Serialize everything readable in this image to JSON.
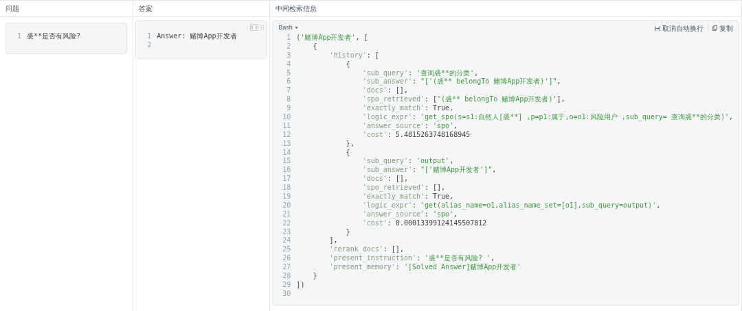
{
  "columns": [
    {
      "header": "问题"
    },
    {
      "header": "答案"
    },
    {
      "header": "中间检索信息"
    }
  ],
  "question": {
    "lines": [
      {
        "n": "1",
        "text": "裘**是否有风险?"
      }
    ]
  },
  "answer": {
    "lines": [
      {
        "n": "1",
        "text": "Answer: 赌博App开发者"
      },
      {
        "n": "2"
      }
    ]
  },
  "retrieval": {
    "language": "Bash",
    "actions": [
      {
        "kind": "wrap",
        "label": "取消自动换行"
      },
      {
        "kind": "copy",
        "label": "复制"
      }
    ],
    "lines": [
      {
        "n": "1",
        "text": "('赌博App开发者', ["
      },
      {
        "n": "2",
        "text": "    {"
      },
      {
        "n": "3",
        "text": "        'history': ["
      },
      {
        "n": "4",
        "text": "            {"
      },
      {
        "n": "5",
        "text": "                'sub_query': '查询裘**的分类',"
      },
      {
        "n": "6",
        "text": "                'sub_answer': \"['(裘** belongTo 赌博App开发者)']\","
      },
      {
        "n": "7",
        "text": "                'docs': [],"
      },
      {
        "n": "8",
        "text": "                'spo_retrieved': ['(裘** belongTo 赌博App开发者)'],"
      },
      {
        "n": "9",
        "text": "                'exactly_match': True,"
      },
      {
        "n": "10",
        "text": "                'logic_expr': 'get_spo(s=s1:自然人[裘**] ,p=p1:属于,o=o1:风险用户 ,sub_query= 查询裘**的分类)',"
      },
      {
        "n": "11",
        "text": "                'answer_source': 'spo',"
      },
      {
        "n": "12",
        "text": "                'cost': 5.4815263748168945"
      },
      {
        "n": "13",
        "text": "            },"
      },
      {
        "n": "14",
        "text": "            {"
      },
      {
        "n": "15",
        "text": "                'sub_query': 'output',"
      },
      {
        "n": "16",
        "text": "                'sub_answer': \"['赌博App开发者']\","
      },
      {
        "n": "17",
        "text": "                'docs': [],"
      },
      {
        "n": "18",
        "text": "                'spo_retrieved': [],"
      },
      {
        "n": "19",
        "text": "                'exactly_match': True,"
      },
      {
        "n": "20",
        "text": "                'logic_expr': 'get(alias_name=o1,alias_name_set=[o1],sub_query=output)',"
      },
      {
        "n": "21",
        "text": "                'answer_source': 'spo',"
      },
      {
        "n": "22",
        "text": "                'cost': 0.00013399124145507812"
      },
      {
        "n": "23",
        "text": "            }"
      },
      {
        "n": "24",
        "text": "        ],"
      },
      {
        "n": "25",
        "text": "        'rerank_docs': [],"
      },
      {
        "n": "26",
        "text": "        'present_instruction': '裘**是否有风险? ',"
      },
      {
        "n": "27",
        "text": "        'present_memory': '[Solved Answer]赌博App开发者'"
      },
      {
        "n": "28",
        "text": "    }"
      },
      {
        "n": "29",
        "text": "])"
      },
      {
        "n": "30"
      }
    ]
  }
}
